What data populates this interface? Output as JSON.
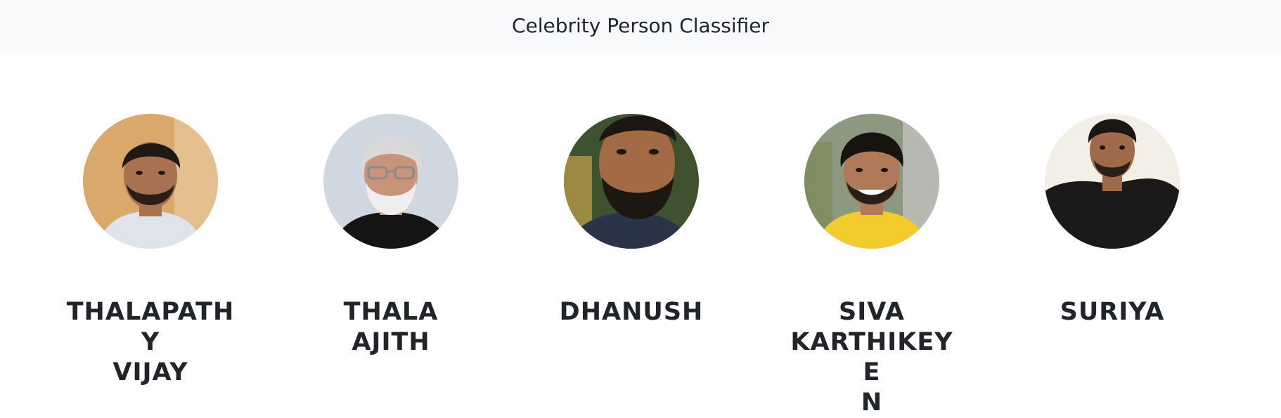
{
  "navbar": {
    "title": "Celebrity Person Classifier"
  },
  "celebrities": [
    {
      "name_lines": [
        "THALAPATHY",
        "VIJAY"
      ],
      "bg": "#d9a86a",
      "skin": "#a8714f",
      "hair": "#1e1915",
      "shirt": "#dfe3ea"
    },
    {
      "name_lines": [
        "THALA",
        "AJITH"
      ],
      "bg": "#cfd8e0",
      "skin": "#c8957a",
      "hair": "#d9d9d9",
      "shirt": "#141414"
    },
    {
      "name_lines": [
        "DHANUSH"
      ],
      "bg": "#3e5230",
      "skin": "#a46a45",
      "hair": "#1d1712",
      "shirt": "#2a3448"
    },
    {
      "name_lines": [
        "SIVA",
        "KARTHIKEYE",
        "N"
      ],
      "bg": "#8c9880",
      "skin": "#b07a58",
      "hair": "#171310",
      "shirt": "#f2cc2c"
    },
    {
      "name_lines": [
        "SURIYA"
      ],
      "bg": "#f1efe6",
      "skin": "#9e6a4a",
      "hair": "#1a1612",
      "shirt": "#1c1a18"
    }
  ]
}
